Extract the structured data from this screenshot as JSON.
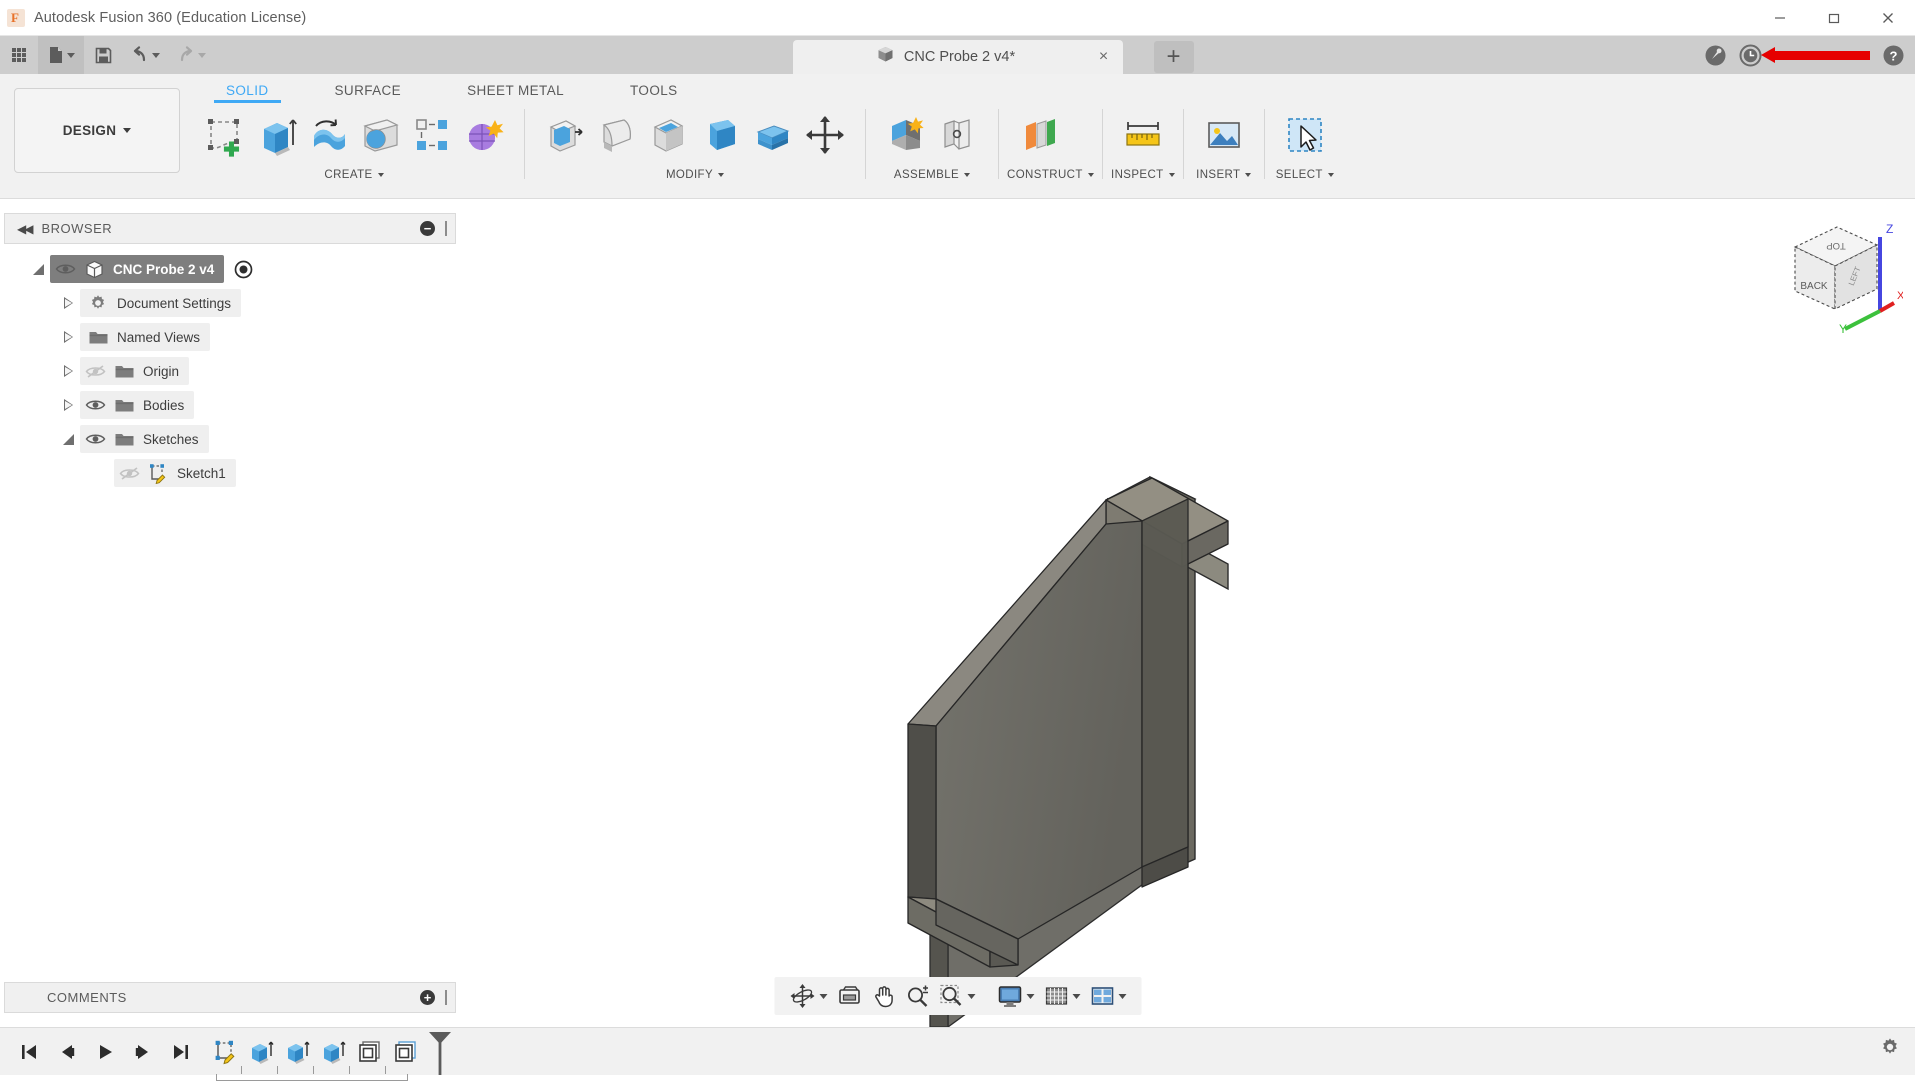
{
  "app": {
    "title": "Autodesk Fusion 360 (Education License)",
    "logo_letter": "F"
  },
  "window_controls": {
    "minimize": "minimize-icon",
    "maximize": "restore-icon",
    "close": "close-icon"
  },
  "quick_access": {
    "items": [
      {
        "name": "app-grid-button",
        "icon": "grid-apps-icon",
        "label": ""
      },
      {
        "name": "new-file-button",
        "icon": "file-icon",
        "label": ""
      },
      {
        "name": "save-button",
        "icon": "save-floppy-icon",
        "label": ""
      },
      {
        "name": "undo-button",
        "icon": "undo-arrow-icon",
        "label": ""
      },
      {
        "name": "redo-button",
        "icon": "redo-arrow-icon",
        "label": ""
      }
    ]
  },
  "document_tab": {
    "label": "CNC Probe 2 v4*",
    "icon": "cube-icon",
    "close_label": "×",
    "add_tab_label": "+"
  },
  "top_right": {
    "items": [
      {
        "name": "extensions-icon",
        "label": ""
      },
      {
        "name": "job-status-icon",
        "label": ""
      },
      {
        "name": "redaction-mark",
        "label": ""
      },
      {
        "name": "help-icon",
        "label": ""
      }
    ],
    "redaction_color": "#e60000"
  },
  "workspace": {
    "selector_label": "DESIGN",
    "tabs": [
      {
        "label": "SOLID",
        "active": true
      },
      {
        "label": "SURFACE",
        "active": false
      },
      {
        "label": "SHEET METAL",
        "active": false
      },
      {
        "label": "TOOLS",
        "active": false
      }
    ],
    "active_tab_color": "#3fa9f5"
  },
  "ribbon_panels": [
    {
      "label": "CREATE",
      "has_dropdown": true,
      "tools": [
        {
          "name": "create-sketch-tool",
          "icon": "sketch-plus-icon"
        },
        {
          "name": "extrude-tool",
          "icon": "extrude-icon"
        },
        {
          "name": "revolve-tool",
          "icon": "revolve-icon"
        },
        {
          "name": "hole-tool",
          "icon": "hole-icon"
        },
        {
          "name": "rectangular-pattern-tool",
          "icon": "pattern-icon"
        },
        {
          "name": "create-form-tool",
          "icon": "form-sculpt-icon"
        }
      ]
    },
    {
      "label": "MODIFY",
      "has_dropdown": true,
      "tools": [
        {
          "name": "press-pull-tool",
          "icon": "press-pull-icon"
        },
        {
          "name": "fillet-tool",
          "icon": "fillet-icon"
        },
        {
          "name": "shell-tool",
          "icon": "shell-icon"
        },
        {
          "name": "draft-tool",
          "icon": "draft-icon"
        },
        {
          "name": "combine-tool",
          "icon": "combine-icon"
        },
        {
          "name": "move-copy-tool",
          "icon": "move-copy-arrows-icon"
        }
      ]
    },
    {
      "label": "ASSEMBLE",
      "has_dropdown": true,
      "tools": [
        {
          "name": "new-component-tool",
          "icon": "new-component-icon"
        },
        {
          "name": "joint-tool",
          "icon": "joint-icon"
        }
      ]
    },
    {
      "label": "CONSTRUCT",
      "has_dropdown": true,
      "tools": [
        {
          "name": "offset-plane-tool",
          "icon": "offset-plane-icon"
        }
      ]
    },
    {
      "label": "INSPECT",
      "has_dropdown": true,
      "tools": [
        {
          "name": "measure-tool",
          "icon": "measure-ruler-icon"
        }
      ]
    },
    {
      "label": "INSERT",
      "has_dropdown": true,
      "tools": [
        {
          "name": "insert-mcmaster-tool",
          "icon": "insert-image-icon"
        }
      ]
    },
    {
      "label": "SELECT",
      "has_dropdown": true,
      "tools": [
        {
          "name": "select-tool",
          "icon": "cursor-select-icon"
        }
      ]
    }
  ],
  "browser": {
    "title": "BROWSER",
    "collapse_label": "◀◀",
    "minus_label": "−",
    "tree": [
      {
        "label": "CNC Probe 2 v4",
        "indent": 0,
        "disclosure": "expanded",
        "eye": "visible",
        "icon": "component-cube-icon",
        "selected": true,
        "has_radio": true
      },
      {
        "label": "Document Settings",
        "indent": 1,
        "disclosure": "collapsed",
        "eye": "none",
        "icon": "gear-icon",
        "selected": false,
        "has_radio": false
      },
      {
        "label": "Named Views",
        "indent": 1,
        "disclosure": "collapsed",
        "eye": "none",
        "icon": "folder-icon",
        "selected": false,
        "has_radio": false
      },
      {
        "label": "Origin",
        "indent": 1,
        "disclosure": "collapsed",
        "eye": "hidden",
        "icon": "folder-icon",
        "selected": false,
        "has_radio": false
      },
      {
        "label": "Bodies",
        "indent": 1,
        "disclosure": "collapsed",
        "eye": "visible",
        "icon": "folder-icon",
        "selected": false,
        "has_radio": false
      },
      {
        "label": "Sketches",
        "indent": 1,
        "disclosure": "expanded",
        "eye": "visible",
        "icon": "folder-icon",
        "selected": false,
        "has_radio": false
      },
      {
        "label": "Sketch1",
        "indent": 2,
        "disclosure": "none",
        "eye": "hidden",
        "icon": "sketch-icon",
        "selected": false,
        "has_radio": false
      }
    ]
  },
  "comments": {
    "title": "COMMENTS",
    "add_label": "+"
  },
  "viewcube": {
    "faces": {
      "top": "TOP",
      "front_left": "BACK",
      "front_right": "LEFT"
    },
    "axes": {
      "x": "X",
      "y": "Y",
      "z": "Z"
    },
    "axis_colors": {
      "x": "#e02020",
      "y": "#3cc13c",
      "z": "#4646e0"
    }
  },
  "navigation_bar": {
    "items": [
      {
        "name": "orbit-tool",
        "icon": "orbit-icon",
        "has_dropdown": true
      },
      {
        "name": "look-at-tool",
        "icon": "look-at-icon",
        "has_dropdown": false
      },
      {
        "name": "pan-tool",
        "icon": "pan-hand-icon",
        "has_dropdown": false
      },
      {
        "name": "zoom-tool",
        "icon": "zoom-magnifier-icon",
        "has_dropdown": false
      },
      {
        "name": "zoom-window-tool",
        "icon": "zoom-window-icon",
        "has_dropdown": true
      },
      {
        "name": "display-settings-tool",
        "icon": "display-monitor-icon",
        "has_dropdown": true
      },
      {
        "name": "grid-snaps-tool",
        "icon": "grid-icon",
        "has_dropdown": true
      },
      {
        "name": "viewports-tool",
        "icon": "viewports-icon",
        "has_dropdown": true
      }
    ]
  },
  "timeline": {
    "playback": [
      {
        "name": "timeline-go-start",
        "icon": "skip-start-icon"
      },
      {
        "name": "timeline-step-back",
        "icon": "step-back-icon"
      },
      {
        "name": "timeline-play",
        "icon": "play-icon"
      },
      {
        "name": "timeline-step-forward",
        "icon": "step-forward-icon"
      },
      {
        "name": "timeline-go-end",
        "icon": "skip-end-icon"
      }
    ],
    "features": [
      {
        "name": "timeline-feature-sketch1",
        "icon": "sketch-icon"
      },
      {
        "name": "timeline-feature-extrude1",
        "icon": "extrude-icon"
      },
      {
        "name": "timeline-feature-extrude2",
        "icon": "extrude-icon"
      },
      {
        "name": "timeline-feature-extrude3",
        "icon": "extrude-icon"
      },
      {
        "name": "timeline-feature-offsetface1",
        "icon": "offset-face-icon"
      },
      {
        "name": "timeline-feature-offsetface2",
        "icon": "offset-face-icon"
      }
    ],
    "end_marker": "timeline-end-marker",
    "settings_icon": "gear-icon"
  },
  "model": {
    "name": "cnc-probe-bracket",
    "colors": {
      "face_front": "#6f6e68",
      "face_top": "#8a877c",
      "face_side": "#57564f",
      "edge": "#2c2c2c"
    }
  }
}
